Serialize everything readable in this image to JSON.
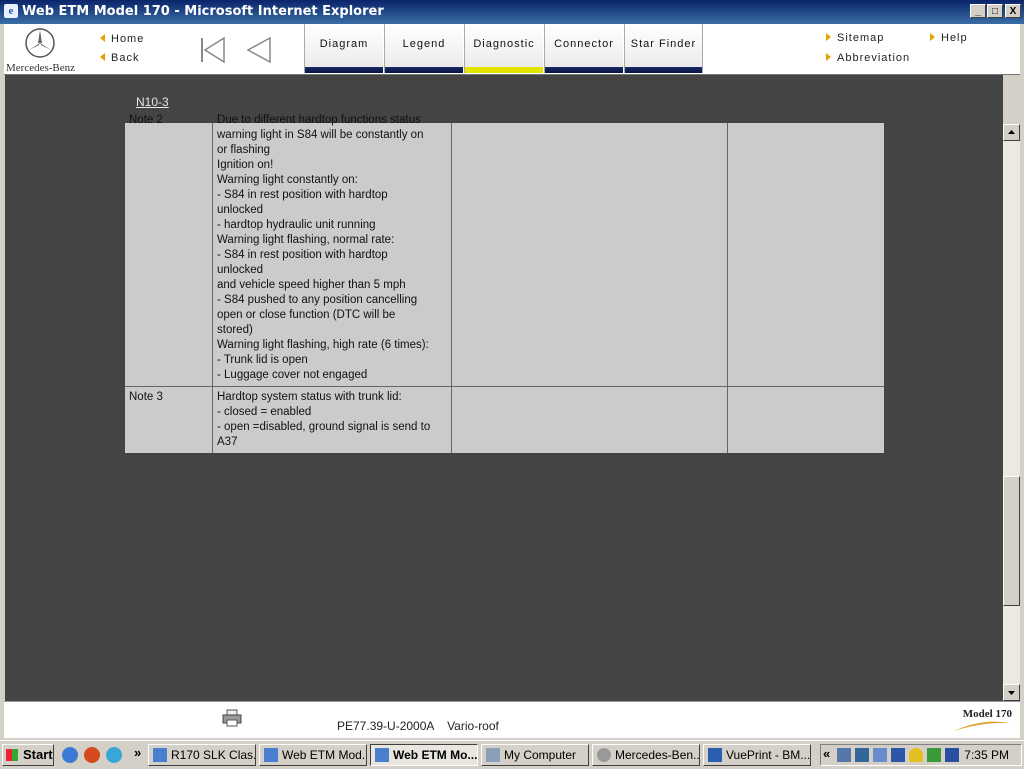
{
  "window": {
    "title": "Web ETM Model 170 - Microsoft Internet Explorer",
    "controls": {
      "minimize": "_",
      "maximize": "□",
      "close": "X"
    }
  },
  "toolbar": {
    "brand": "Mercedes-Benz",
    "home": "Home",
    "back": "Back",
    "tabs": [
      "Diagram",
      "Legend",
      "Diagnostic",
      "Connector",
      "Star Finder"
    ],
    "active_tab": "Diagnostic",
    "sitemap": "Sitemap",
    "help": "Help",
    "abbreviation": "Abbreviation"
  },
  "content": {
    "breadcrumb": "N10-3",
    "rows": [
      {
        "label": "Note 2",
        "lines": [
          "Due to different hardtop functions status",
          "warning light in S84 will be constantly on",
          "or flashing",
          "Ignition on!",
          "Warning light constantly on:",
          "- S84 in rest position with hardtop",
          "unlocked",
          "- hardtop hydraulic unit running",
          "Warning light flashing, normal rate:",
          "- S84 in rest position with hardtop",
          "unlocked",
          "and vehicle speed higher than 5 mph",
          "- S84 pushed to any position cancelling",
          "open or close function (DTC will be",
          "stored)",
          "Warning light flashing, high rate (6 times):",
          "- Trunk lid is open",
          "- Luggage cover not engaged"
        ]
      },
      {
        "label": "Note 3",
        "lines": [
          "Hardtop system status with trunk lid:",
          "- closed = enabled",
          "- open =disabled, ground signal is send to",
          "A37"
        ]
      }
    ]
  },
  "footer": {
    "doc_id": "PE77.39-U-2000A    Vario-roof",
    "model_label": "Model 170"
  },
  "taskbar": {
    "start": "Start",
    "more": "»",
    "tasks": [
      {
        "label": "R170 SLK Clas...",
        "active": false
      },
      {
        "label": "Web ETM Mod...",
        "active": false
      },
      {
        "label": "Web ETM Mo...",
        "active": true
      },
      {
        "label": "My Computer",
        "active": false
      },
      {
        "label": "Mercedes-Ben...",
        "active": false
      },
      {
        "label": "VuePrint - BM...",
        "active": false
      }
    ],
    "tray_collapse": "«",
    "clock": "7:35 PM"
  },
  "colors": {
    "title_bar": "#0a246a",
    "content_bg": "#444444",
    "table_bg": "#cbcbcb",
    "tab_bar": "#1a2a6a",
    "active_tab_bar": "#e4e400",
    "accent_arrow": "#e8a000"
  }
}
